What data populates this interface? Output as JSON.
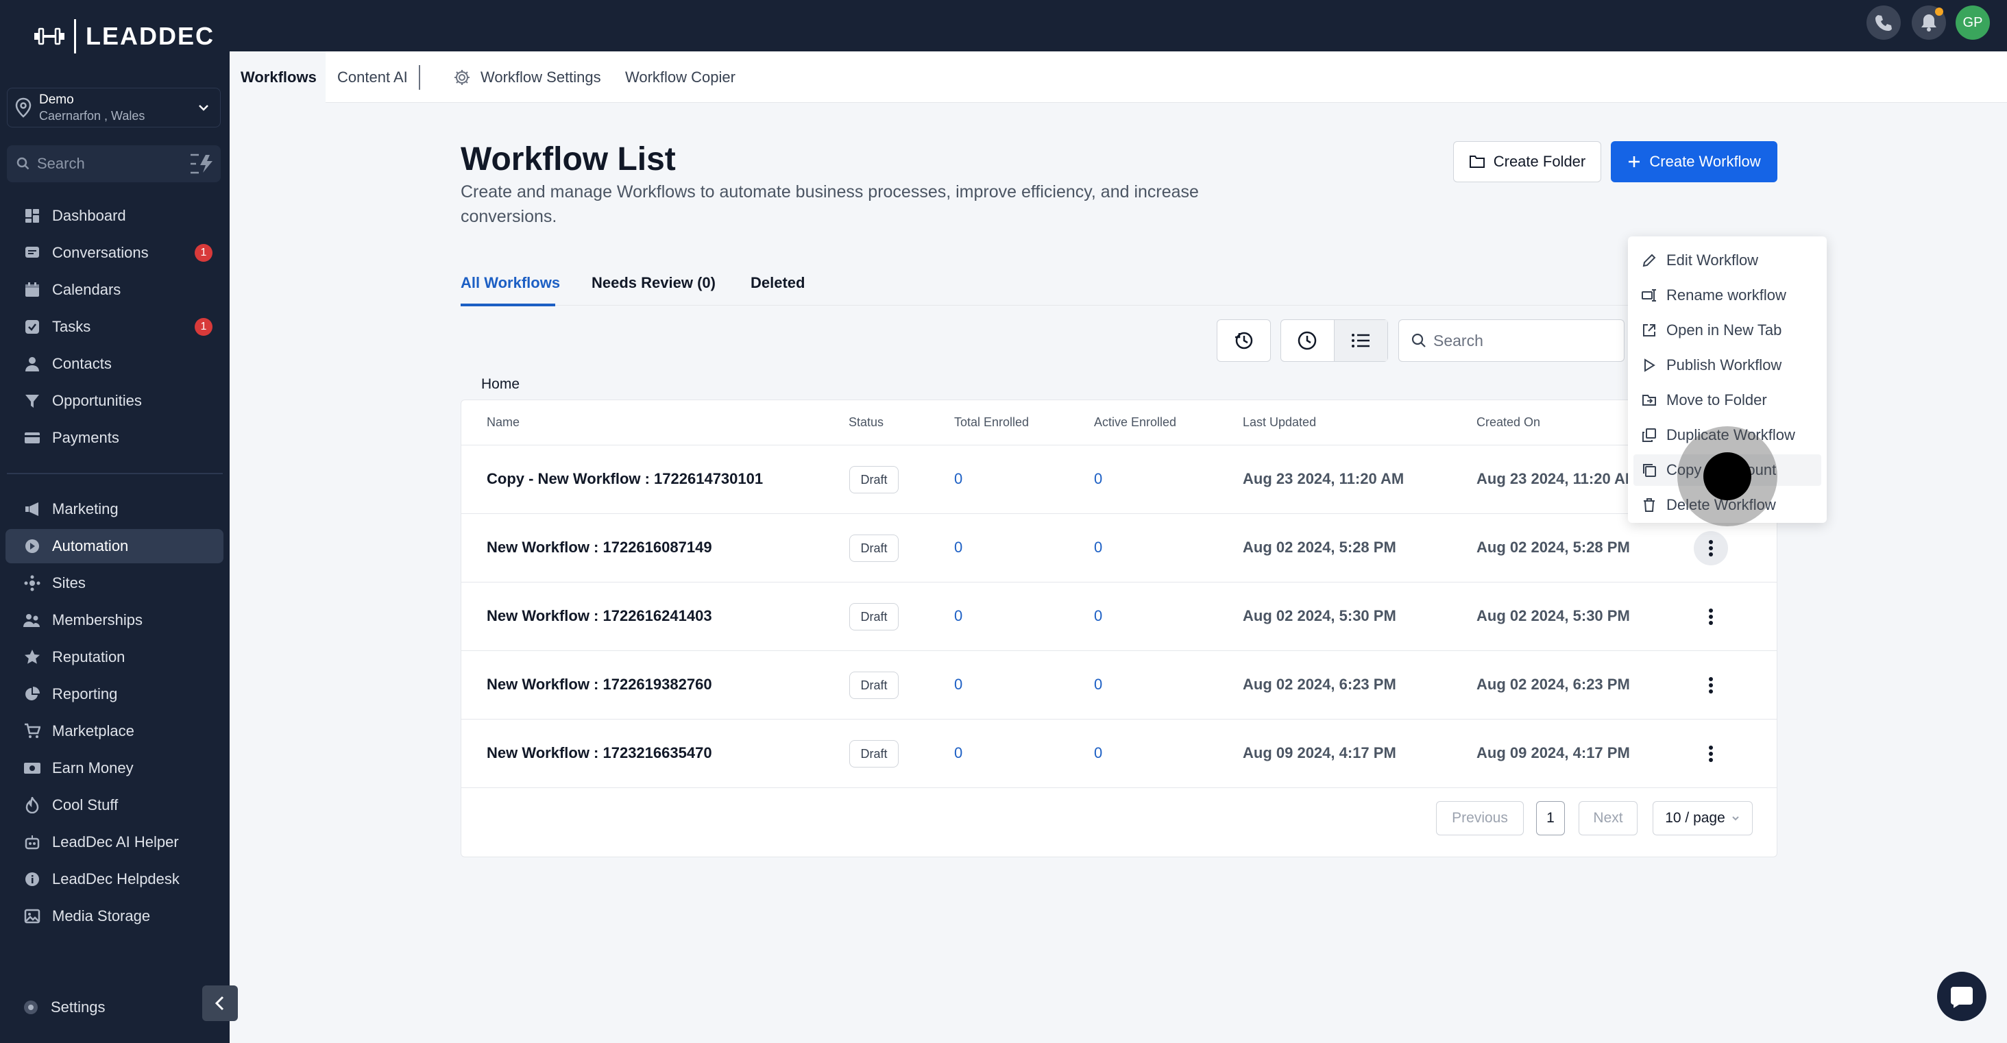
{
  "app": {
    "brand": "LEADDEC"
  },
  "location": {
    "name": "Demo",
    "address": "Caernarfon , Wales"
  },
  "sidebar": {
    "search_placeholder": "Search",
    "items": [
      {
        "label": "Dashboard",
        "icon": "dashboard-icon"
      },
      {
        "label": "Conversations",
        "icon": "chat-icon",
        "badge": "1"
      },
      {
        "label": "Calendars",
        "icon": "calendar-icon"
      },
      {
        "label": "Tasks",
        "icon": "check-square-icon",
        "badge": "1"
      },
      {
        "label": "Contacts",
        "icon": "user-icon"
      },
      {
        "label": "Opportunities",
        "icon": "filter-icon"
      },
      {
        "label": "Payments",
        "icon": "credit-card-icon"
      },
      {
        "label": "Marketing",
        "icon": "megaphone-icon"
      },
      {
        "label": "Automation",
        "icon": "automation-icon",
        "active": true
      },
      {
        "label": "Sites",
        "icon": "sites-icon"
      },
      {
        "label": "Memberships",
        "icon": "users-icon"
      },
      {
        "label": "Reputation",
        "icon": "star-icon"
      },
      {
        "label": "Reporting",
        "icon": "chart-pie-icon"
      },
      {
        "label": "Marketplace",
        "icon": "cart-icon"
      },
      {
        "label": "Earn Money",
        "icon": "money-icon"
      },
      {
        "label": "Cool Stuff",
        "icon": "flame-icon"
      },
      {
        "label": "LeadDec AI Helper",
        "icon": "robot-icon"
      },
      {
        "label": "LeadDec Helpdesk",
        "icon": "info-icon"
      },
      {
        "label": "Media Storage",
        "icon": "image-icon"
      }
    ],
    "settings_label": "Settings"
  },
  "topbar": {
    "avatar_initials": "GP"
  },
  "subnav": {
    "tabs": [
      "Workflows",
      "Content AI",
      "Workflow Settings",
      "Workflow Copier"
    ]
  },
  "page": {
    "title": "Workflow List",
    "description": "Create and manage Workflows to automate business processes, improve efficiency, and increase conversions.",
    "create_folder": "Create Folder",
    "create_workflow": "Create Workflow"
  },
  "tabs": [
    "All Workflows",
    "Needs Review (0)",
    "Deleted"
  ],
  "toolbar": {
    "search_placeholder": "Search"
  },
  "breadcrumb": "Home",
  "table": {
    "columns": [
      "Name",
      "Status",
      "Total Enrolled",
      "Active Enrolled",
      "Last Updated",
      "Created On"
    ],
    "rows": [
      {
        "name": "Copy - New Workflow : 1722614730101",
        "status": "Draft",
        "total": "0",
        "active": "0",
        "updated": "Aug 23 2024, 11:20 AM",
        "created": "Aug 23 2024, 11:20 AM"
      },
      {
        "name": "New Workflow : 1722616087149",
        "status": "Draft",
        "total": "0",
        "active": "0",
        "updated": "Aug 02 2024, 5:28 PM",
        "created": "Aug 02 2024, 5:28 PM"
      },
      {
        "name": "New Workflow : 1722616241403",
        "status": "Draft",
        "total": "0",
        "active": "0",
        "updated": "Aug 02 2024, 5:30 PM",
        "created": "Aug 02 2024, 5:30 PM"
      },
      {
        "name": "New Workflow : 1722619382760",
        "status": "Draft",
        "total": "0",
        "active": "0",
        "updated": "Aug 02 2024, 6:23 PM",
        "created": "Aug 02 2024, 6:23 PM"
      },
      {
        "name": "New Workflow : 1723216635470",
        "status": "Draft",
        "total": "0",
        "active": "0",
        "updated": "Aug 09 2024, 4:17 PM",
        "created": "Aug 09 2024, 4:17 PM"
      }
    ]
  },
  "pagination": {
    "previous": "Previous",
    "page": "1",
    "next": "Next",
    "per_page": "10 / page"
  },
  "context_menu": {
    "items": [
      "Edit Workflow",
      "Rename workflow",
      "Open in New Tab",
      "Publish Workflow",
      "Move to Folder",
      "Duplicate Workflow",
      "Copy to Account",
      "Delete Workflow"
    ],
    "highlighted": "Copy to Account"
  },
  "colors": {
    "sidebar_bg": "#182235",
    "accent": "#1564e6",
    "link": "#1c5fc4",
    "badge": "#d83a3a"
  }
}
